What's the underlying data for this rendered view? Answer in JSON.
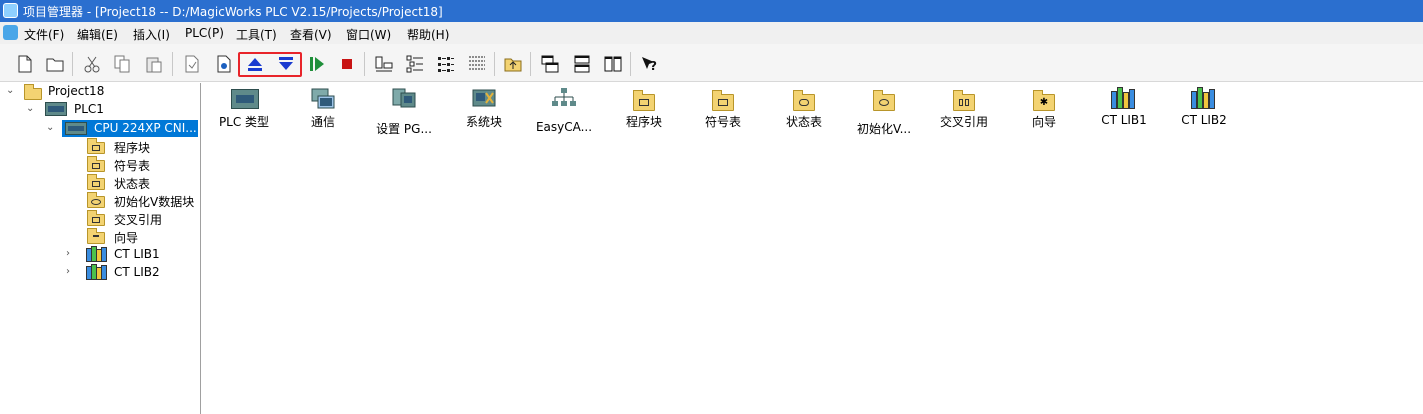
{
  "window": {
    "title": "项目管理器 - [Project18 -- D:/MagicWorks PLC V2.15/Projects/Project18]"
  },
  "menu": [
    {
      "label": "文件(F)"
    },
    {
      "label": "编辑(E)"
    },
    {
      "label": "插入(I)"
    },
    {
      "label": "PLC(P)"
    },
    {
      "label": "工具(T)"
    },
    {
      "label": "查看(V)"
    },
    {
      "label": "窗口(W)"
    },
    {
      "label": "帮助(H)"
    }
  ],
  "toolbar": {
    "buttons": [
      "new-icon",
      "open-icon",
      "cut-icon",
      "copy-icon",
      "paste-icon",
      "import-icon",
      "export-icon",
      "upload-icon",
      "download-icon",
      "run-icon",
      "stop-icon",
      "large-icons-icon",
      "small-icons-icon",
      "list-icon",
      "details-icon",
      "up-folder-icon",
      "cascade-icon",
      "tile-horizontal-icon",
      "tile-vertical-icon",
      "help-icon"
    ],
    "highlight_color": "#e8242a"
  },
  "tree": {
    "root": "Project18",
    "plc": "PLC1",
    "cpu": "CPU 224XP CNI...",
    "children": [
      {
        "label": "程序块",
        "icon": "program-block-folder-icon"
      },
      {
        "label": "符号表",
        "icon": "symbol-table-folder-icon"
      },
      {
        "label": "状态表",
        "icon": "status-table-folder-icon"
      },
      {
        "label": "初始化V数据块",
        "icon": "data-block-folder-icon"
      },
      {
        "label": "交叉引用",
        "icon": "cross-reference-folder-icon"
      },
      {
        "label": "向导",
        "icon": "wizard-folder-icon"
      }
    ],
    "libs": [
      "CT LIB1",
      "CT LIB2"
    ]
  },
  "content": {
    "items": [
      {
        "label": "PLC 类型",
        "icon": "plc-type-icon"
      },
      {
        "label": "通信",
        "icon": "communication-icon"
      },
      {
        "label": "设置 PG...",
        "icon": "set-pg-icon"
      },
      {
        "label": "系统块",
        "icon": "system-block-icon"
      },
      {
        "label": "EasyCA...",
        "icon": "easycan-icon"
      },
      {
        "label": "程序块",
        "icon": "program-block-icon"
      },
      {
        "label": "符号表",
        "icon": "symbol-table-icon"
      },
      {
        "label": "状态表",
        "icon": "status-table-icon"
      },
      {
        "label": "初始化V...",
        "icon": "init-v-icon"
      },
      {
        "label": "交叉引用",
        "icon": "cross-reference-icon"
      },
      {
        "label": "向导",
        "icon": "wizard-icon"
      },
      {
        "label": "CT LIB1",
        "icon": "library-icon"
      },
      {
        "label": "CT LIB2",
        "icon": "library-icon"
      }
    ]
  }
}
